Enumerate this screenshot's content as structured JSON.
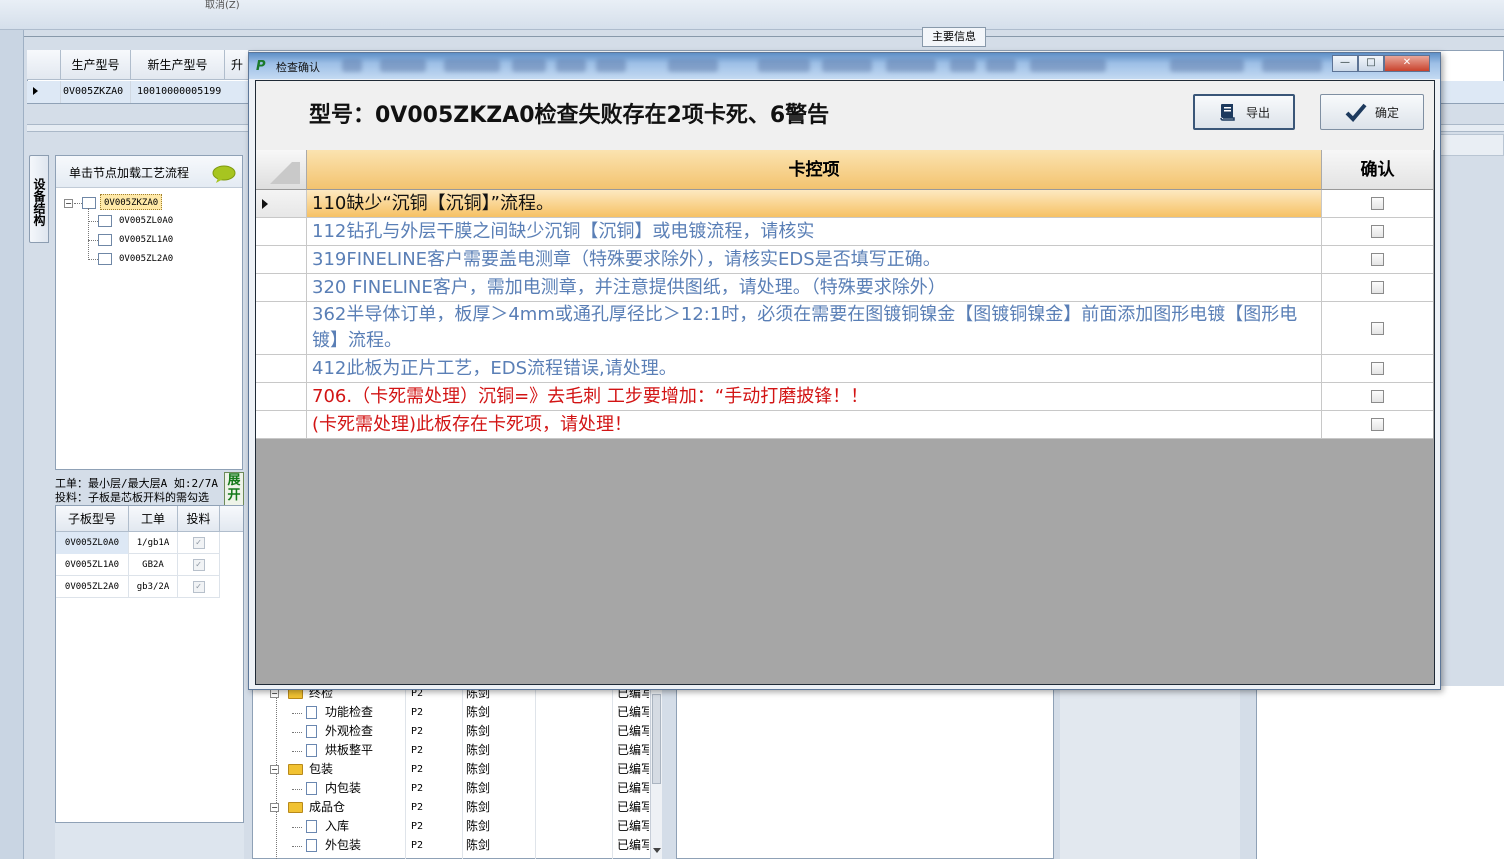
{
  "background": {
    "top_cancel_label": "取消(Z)",
    "main_info_tab": "主要信息",
    "grid1": {
      "headers": [
        "生产型号",
        "新生产型号",
        "升"
      ],
      "row": [
        "0V005ZKZA0",
        "10010000005199"
      ]
    },
    "side_tab": "设备结构",
    "tree": {
      "header": "单击节点加载工艺流程",
      "root": "0V005ZKZA0",
      "children": [
        "0V005ZL0A0",
        "0V005ZL1A0",
        "0V005ZL2A0"
      ]
    },
    "note_line1": "工单：最小层/最大层A 如:2/7A",
    "note_line2": "投料：子板是芯板开料的需勾选",
    "expand_button": "展开",
    "sub_grid": {
      "headers": [
        "子板型号",
        "工单",
        "投料"
      ],
      "rows": [
        {
          "model": "0V005ZL0A0",
          "order": "1/gb1A",
          "checked": true
        },
        {
          "model": "0V005ZL1A0",
          "order": "GB2A",
          "checked": true
        },
        {
          "model": "0V005ZL2A0",
          "order": "gb3/2A",
          "checked": true
        }
      ]
    },
    "process_rows": [
      {
        "name": "终检",
        "type": "folder",
        "level": 1,
        "col2": "P2",
        "col3": "陈剑",
        "col4": "已编写"
      },
      {
        "name": "功能检查",
        "type": "doc",
        "level": 2,
        "col2": "P2",
        "col3": "陈剑",
        "col4": "已编写"
      },
      {
        "name": "外观检查",
        "type": "doc",
        "level": 2,
        "col2": "P2",
        "col3": "陈剑",
        "col4": "已编写"
      },
      {
        "name": "烘板整平",
        "type": "doc",
        "level": 2,
        "col2": "P2",
        "col3": "陈剑",
        "col4": "已编写"
      },
      {
        "name": "包装",
        "type": "folder",
        "level": 1,
        "col2": "P2",
        "col3": "陈剑",
        "col4": "已编写"
      },
      {
        "name": "内包装",
        "type": "doc",
        "level": 2,
        "col2": "P2",
        "col3": "陈剑",
        "col4": "已编写"
      },
      {
        "name": "成品仓",
        "type": "folder",
        "level": 1,
        "col2": "P2",
        "col3": "陈剑",
        "col4": "已编写"
      },
      {
        "name": "入库",
        "type": "doc",
        "level": 2,
        "col2": "P2",
        "col3": "陈剑",
        "col4": "已编写"
      },
      {
        "name": "外包装",
        "type": "doc",
        "level": 2,
        "col2": "P2",
        "col3": "陈剑",
        "col4": "已编写"
      }
    ]
  },
  "dialog": {
    "title": "检查确认",
    "window_buttons": {
      "minimize": "—",
      "maximize": "□",
      "close": "✕"
    },
    "heading": "型号：0V005ZKZA0检查失败存在2项卡死、6警告",
    "export_label": "导出",
    "confirm_label": "确定",
    "table": {
      "col_item": "卡控项",
      "col_confirm": "确认",
      "rows": [
        {
          "text": "110缺少“沉铜【沉铜】”流程。",
          "color": "black",
          "selected": true,
          "checked": false
        },
        {
          "text": "112钻孔与外层干膜之间缺少沉铜【沉铜】或电镀流程，请核实",
          "color": "blue",
          "selected": false,
          "checked": false
        },
        {
          "text": "319FINELINE客户需要盖电测章（特殊要求除外），请核实EDS是否填写正确。",
          "color": "blue",
          "selected": false,
          "checked": false
        },
        {
          "text": "320 FINELINE客户，需加电测章，并注意提供图纸，请处理。（特殊要求除外）",
          "color": "blue",
          "selected": false,
          "checked": false
        },
        {
          "text": "362半导体订单，板厚＞4mm或通孔厚径比＞12:1时，必须在需要在图镀铜镍金【图镀铜镍金】前面添加图形电镀【图形电镀】流程。",
          "color": "blue",
          "selected": false,
          "checked": false
        },
        {
          "text": "412此板为正片工艺，EDS流程错误,请处理。",
          "color": "blue",
          "selected": false,
          "checked": false
        },
        {
          "text": "706.（卡死需处理）沉铜=》去毛刺 工步要增加：“手动打磨披锋！！",
          "color": "red",
          "selected": false,
          "checked": false
        },
        {
          "text": "(卡死需处理)此板存在卡死项，请处理！",
          "color": "red",
          "selected": false,
          "checked": false
        }
      ]
    }
  }
}
